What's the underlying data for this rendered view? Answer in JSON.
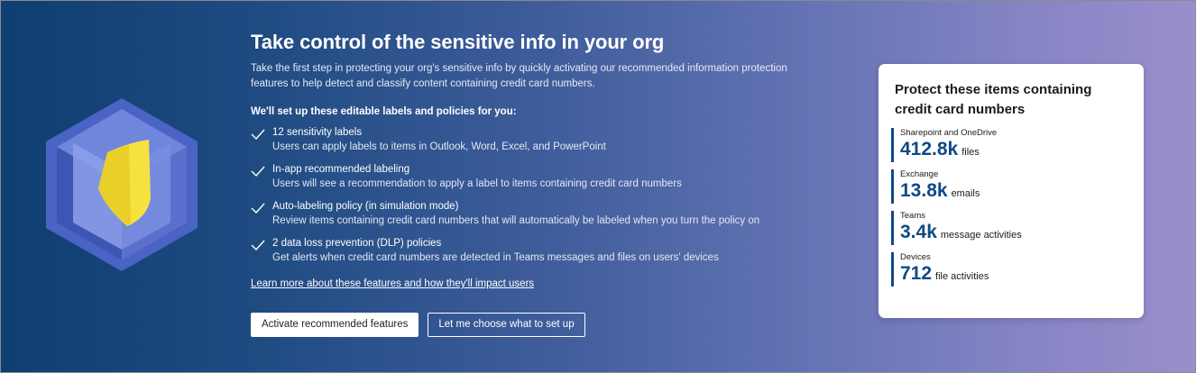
{
  "banner": {
    "title": "Take control of the sensitive info in your org",
    "intro": "Take the first step in protecting your org's sensitive info by quickly activating our recommended information protection features to help detect and classify content containing credit card numbers.",
    "setup_heading": "We'll set up these editable labels and policies for you:",
    "features": [
      {
        "title": "12 sensitivity labels",
        "description": "Users can apply labels to items in Outlook, Word, Excel, and PowerPoint"
      },
      {
        "title": "In-app recommended labeling",
        "description": "Users will see a recommendation to apply a label to items containing credit card numbers"
      },
      {
        "title": "Auto-labeling policy (in simulation mode)",
        "description": "Review items containing credit card numbers that will automatically be labeled when you turn the policy on"
      },
      {
        "title": "2 data loss prevention (DLP) policies",
        "description": "Get alerts when credit card numbers are detected in Teams messages and files on users' devices"
      }
    ],
    "learn_more_link": "Learn more about these features and how they'll impact users",
    "primary_button": "Activate recommended features",
    "secondary_button": "Let me choose what to set up",
    "icons": {
      "illustration": "shield-cube-icon",
      "check": "checkmark-icon"
    }
  },
  "summary_card": {
    "title": "Protect these items containing credit card numbers",
    "stats": [
      {
        "label": "Sharepoint and OneDrive",
        "value": "412.8k",
        "unit": "files"
      },
      {
        "label": "Exchange",
        "value": "13.8k",
        "unit": "emails"
      },
      {
        "label": "Teams",
        "value": "3.4k",
        "unit": "message activities"
      },
      {
        "label": "Devices",
        "value": "712",
        "unit": "file activities"
      }
    ]
  },
  "colors": {
    "gradient_start": "#0f3e72",
    "gradient_end": "#9a8fcd",
    "stat_accent": "#0f4a86",
    "shield": "#f5e23e"
  }
}
